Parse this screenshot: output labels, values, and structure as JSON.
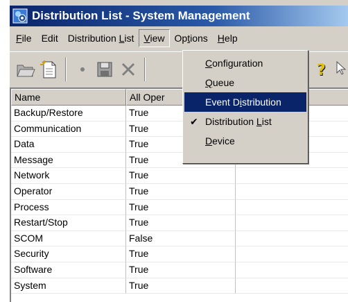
{
  "window": {
    "title": "Distribution List - System Management"
  },
  "menubar": {
    "items": [
      {
        "label": "File"
      },
      {
        "label": "Edit"
      },
      {
        "label": "Distribution List"
      },
      {
        "label": "View"
      },
      {
        "label": "Options"
      },
      {
        "label": "Help"
      }
    ]
  },
  "toolbar": {
    "icons": [
      "open-folder-icon",
      "new-document-icon",
      "dot-icon",
      "save-icon",
      "delete-icon",
      "help-icon"
    ]
  },
  "view_menu": {
    "items": [
      {
        "label": "Configuration",
        "checked": false,
        "highlighted": false
      },
      {
        "label": "Queue",
        "checked": false,
        "highlighted": false
      },
      {
        "label": "Event Distribution",
        "checked": false,
        "highlighted": true
      },
      {
        "label": "Distribution List",
        "checked": true,
        "highlighted": false
      },
      {
        "label": "Device",
        "checked": false,
        "highlighted": false
      }
    ]
  },
  "list": {
    "columns": [
      "Name",
      "All Oper"
    ],
    "rows": [
      {
        "name": "Backup/Restore",
        "all": "True"
      },
      {
        "name": "Communication",
        "all": "True"
      },
      {
        "name": "Data",
        "all": "True"
      },
      {
        "name": "Message",
        "all": "True"
      },
      {
        "name": "Network",
        "all": "True"
      },
      {
        "name": "Operator",
        "all": "True"
      },
      {
        "name": "Process",
        "all": "True"
      },
      {
        "name": "Restart/Stop",
        "all": "True"
      },
      {
        "name": "SCOM",
        "all": "False"
      },
      {
        "name": "Security",
        "all": "True"
      },
      {
        "name": "Software",
        "all": "True"
      },
      {
        "name": "System",
        "all": "True"
      }
    ]
  },
  "colors": {
    "titlebar": "#0a246a",
    "highlight": "#0a246a",
    "face": "#d4d0c8"
  }
}
